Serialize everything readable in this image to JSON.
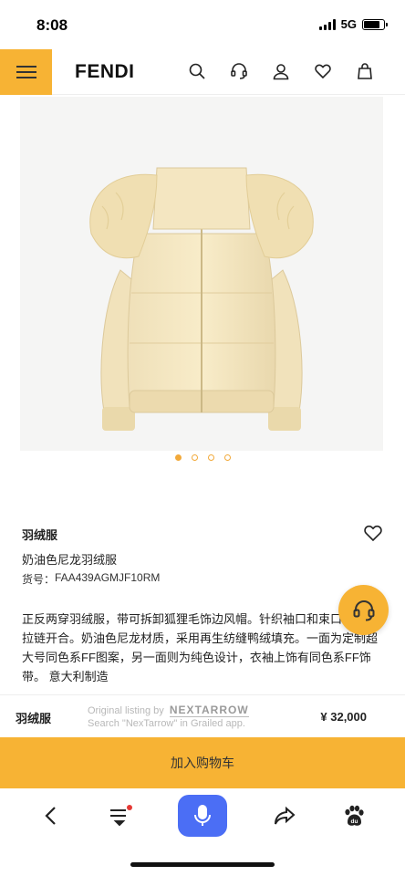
{
  "status": {
    "time": "8:08",
    "network": "5G"
  },
  "header": {
    "brand": "FENDI",
    "icons": [
      "search-icon",
      "headset-icon",
      "account-icon",
      "heart-icon",
      "shopping-bag-icon"
    ]
  },
  "gallery": {
    "image": "cream puffer jacket with detachable fur-trimmed hood",
    "slide_count": 4,
    "active_slide": 1
  },
  "product": {
    "category": "羽绒服",
    "name": "奶油色尼龙羽绒服",
    "code_label": "货号：",
    "code": "FAA439AGMJF10RM",
    "description": "正反两穿羽绒服，带可拆卸狐狸毛饰边风帽。针织袖口和束口下摆。拉链开合。奶油色尼龙材质，采用再生纺缝鸭绒填充。一面为定制超大号同色系FF图案，另一面则为纯色设计，衣袖上饰有同色系FF饰带。 意大利制造"
  },
  "sticky": {
    "name": "羽绒服",
    "price": "¥  32,000",
    "watermark_line1": "Original listing by",
    "watermark_brand": "NEXTARROW",
    "watermark_line2": "Search \"NexTarrow\" in Grailed app."
  },
  "cart": {
    "label": "加入购物车"
  },
  "colors": {
    "accent": "#f7b334",
    "mic": "#4b6ef5",
    "dot": "#f2a93a"
  }
}
